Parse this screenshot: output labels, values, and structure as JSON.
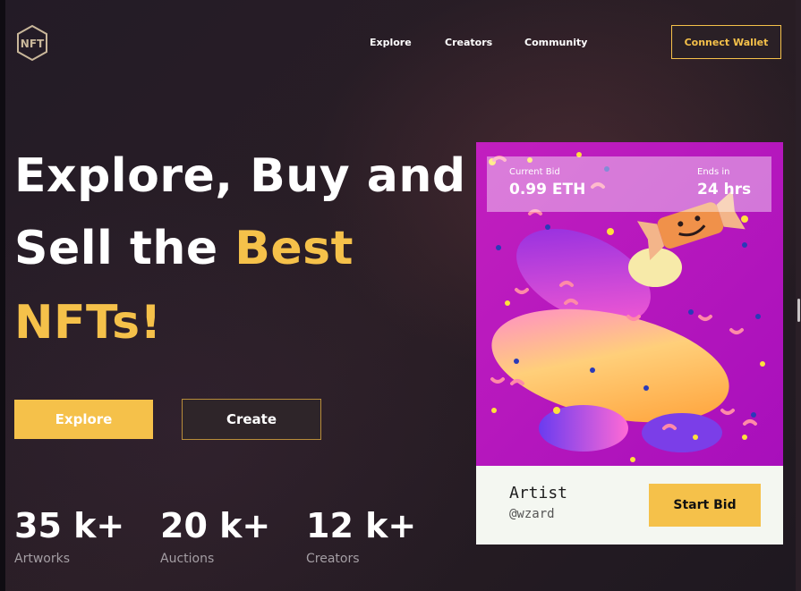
{
  "brand": {
    "logo_text": "NFT"
  },
  "nav": {
    "items": [
      "Explore",
      "Creators",
      "Community"
    ],
    "connect_label": "Connect Wallet"
  },
  "hero": {
    "line1": "Explore, Buy and",
    "line2": "Sell the ",
    "line2_accent": "Best",
    "line3_accent": "NFTs!"
  },
  "actions": {
    "explore_label": "Explore",
    "create_label": "Create"
  },
  "stats": [
    {
      "value": "35 k+",
      "label": "Artworks"
    },
    {
      "value": "20 k+",
      "label": "Auctions"
    },
    {
      "value": "12 k+",
      "label": "Creators"
    }
  ],
  "card": {
    "current_bid_label": "Current Bid",
    "current_bid_value": "0.99 ETH",
    "ends_in_label": "Ends in",
    "ends_in_value": "24 hrs",
    "artist_label": "Artist",
    "artist_handle": "@wzard",
    "start_bid_label": "Start Bid"
  },
  "colors": {
    "accent": "#f5c14a",
    "background": "#1f1923",
    "card_art": "#b316c0"
  }
}
